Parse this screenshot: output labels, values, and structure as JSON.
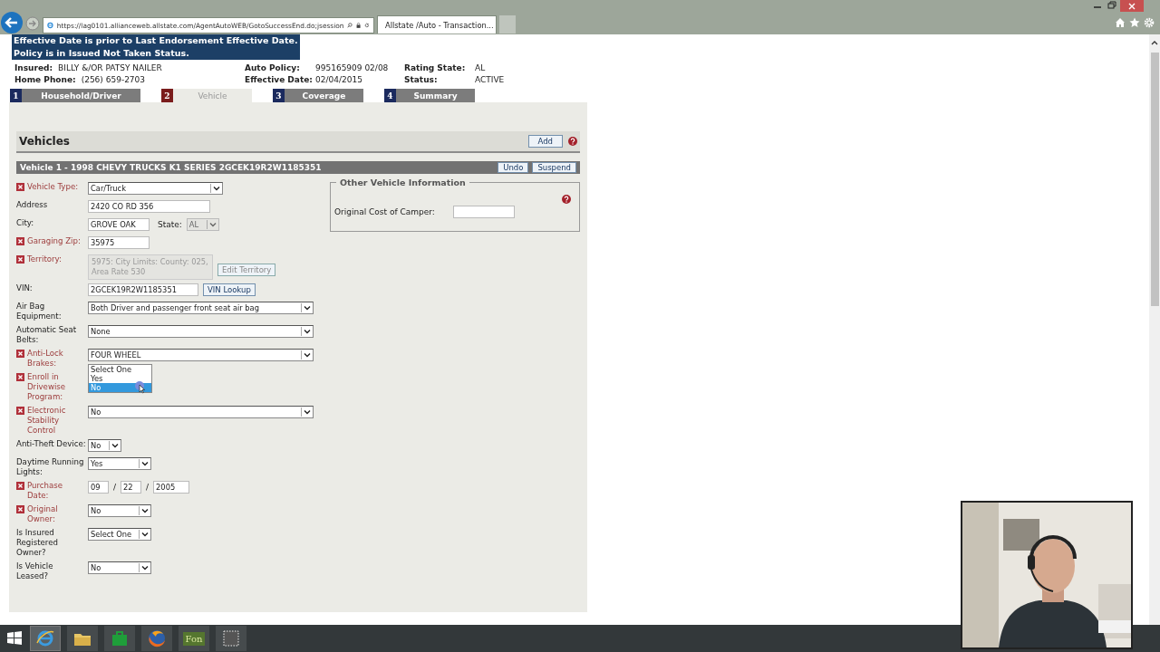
{
  "browser": {
    "url": "https://lag0101.allianceweb.allstate.com/AgentAutoWEB/GotoSuccessEnd.do;jsession",
    "tab_title": "Allstate /Auto - Transaction..."
  },
  "banner": {
    "lines": [
      "Effective Date is prior to Last Endorsement Effective Date.",
      "Policy is in Issued Not Taken Status."
    ]
  },
  "policy_info": [
    [
      {
        "label": "Insured:",
        "value": "BILLY &/OR PATSY NAILER"
      },
      {
        "label": "Home Phone:",
        "value": "(256) 659-2703"
      }
    ],
    [
      {
        "label": "Auto Policy:",
        "value": "995165909 02/08"
      },
      {
        "label": "Effective Date:",
        "value": "02/04/2015"
      }
    ],
    [
      {
        "label": "Rating State:",
        "value": "AL"
      },
      {
        "label": "Status:",
        "value": "ACTIVE"
      }
    ]
  ],
  "steps": [
    {
      "number": "1",
      "label": "Household/Driver",
      "selected": false
    },
    {
      "number": "2",
      "label": "Vehicle",
      "selected": true
    },
    {
      "number": "3",
      "label": "Coverage",
      "selected": false
    },
    {
      "number": "4",
      "label": "Summary",
      "selected": false
    }
  ],
  "section": {
    "title": "Vehicles",
    "add_button": "Add"
  },
  "vehicle": {
    "title": "Vehicle 1 - 1998 CHEVY TRUCKS K1 SERIES 2GCEK19R2W1185351",
    "buttons": [
      "Undo",
      "Suspend"
    ],
    "fields": [
      {
        "label": "Vehicle Type:",
        "required": true,
        "kind": "select",
        "value": "Car/Truck"
      },
      {
        "label": "Address",
        "required": false,
        "kind": "text",
        "value": "2420 CO RD 356"
      },
      {
        "label": "City:",
        "required": false,
        "kind": "city_state",
        "value": "GROVE OAK",
        "state_label": "State:",
        "state_value": "AL",
        "state_disabled": true
      },
      {
        "label": "Garaging Zip:",
        "required": true,
        "kind": "text",
        "value": "35975"
      },
      {
        "label": "Territory:",
        "required": true,
        "kind": "territory",
        "value": "5975:  City Limits:  County: 025, Area Rate 530",
        "button": "Edit Territory"
      },
      {
        "label": "VIN:",
        "required": false,
        "kind": "text_button",
        "value": "2GCEK19R2W1185351",
        "button": "VIN Lookup"
      },
      {
        "label": "Air Bag Equipment:",
        "required": false,
        "kind": "select",
        "value": "Both Driver and passenger front seat air bag"
      },
      {
        "label": "Automatic Seat Belts:",
        "required": false,
        "kind": "select",
        "value": "None"
      },
      {
        "label": "Anti-Lock Brakes:",
        "required": true,
        "kind": "select",
        "value": "FOUR WHEEL"
      },
      {
        "label": "Enroll in Drivewise Program:",
        "required": true,
        "kind": "select",
        "open": true,
        "options": [
          {
            "label": "Select One",
            "selected": false
          },
          {
            "label": "Yes",
            "selected": false
          },
          {
            "label": "No",
            "selected": true
          }
        ]
      },
      {
        "label": "Electronic Stability Control",
        "required": true,
        "kind": "select",
        "value": "No"
      },
      {
        "label": "Anti-Theft Device:",
        "required": false,
        "kind": "select",
        "value": "No"
      },
      {
        "label": "Daytime Running Lights:",
        "required": false,
        "kind": "select",
        "value": "Yes"
      },
      {
        "label": "Purchase Date:",
        "required": true,
        "kind": "date",
        "month": "09",
        "sep1": "/",
        "day": "22",
        "sep2": "/",
        "year": "2005"
      },
      {
        "label": "Original Owner:",
        "required": true,
        "kind": "select",
        "value": "No"
      },
      {
        "label": "Is Insured Registered Owner?",
        "required": false,
        "kind": "select",
        "value": "Select One"
      },
      {
        "label": "Is Vehicle Leased?",
        "required": false,
        "kind": "select",
        "value": "No"
      }
    ]
  },
  "other_info": {
    "title": "Other Vehicle Information",
    "field_label": "Original Cost of Camper:"
  },
  "taskbar": [
    {
      "kind": "start"
    },
    {
      "kind": "ie"
    },
    {
      "kind": "folder"
    },
    {
      "kind": "store"
    },
    {
      "kind": "firefox"
    },
    {
      "kind": "app",
      "label": "Fon"
    },
    {
      "kind": "capture"
    }
  ],
  "webcam": {
    "kind": "picture"
  }
}
